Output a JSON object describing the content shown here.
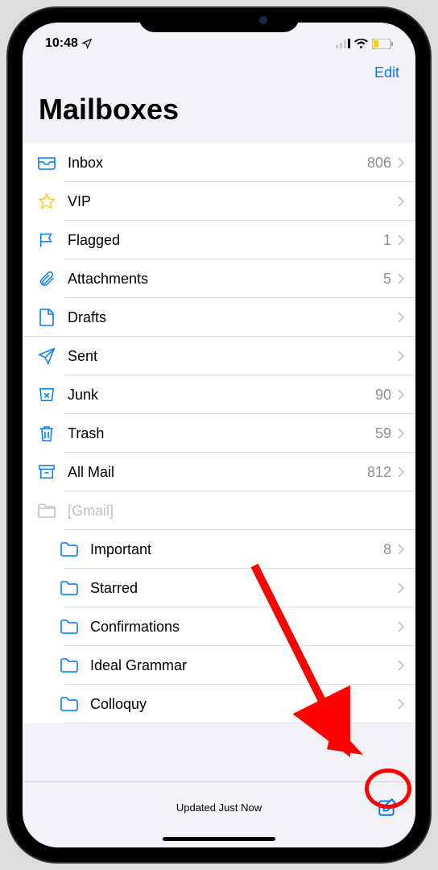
{
  "status": {
    "time": "10:48",
    "location_icon": "location-arrow"
  },
  "nav": {
    "edit_label": "Edit"
  },
  "title": "Mailboxes",
  "mailboxes": [
    {
      "icon": "inbox",
      "label": "Inbox",
      "count": "806",
      "indent": false
    },
    {
      "icon": "star",
      "label": "VIP",
      "count": "",
      "indent": false
    },
    {
      "icon": "flag",
      "label": "Flagged",
      "count": "1",
      "indent": false
    },
    {
      "icon": "paperclip",
      "label": "Attachments",
      "count": "5",
      "indent": false
    },
    {
      "icon": "draft",
      "label": "Drafts",
      "count": "",
      "indent": false,
      "fullBorder": true
    },
    {
      "icon": "paperplane",
      "label": "Sent",
      "count": "",
      "indent": false
    },
    {
      "icon": "junk",
      "label": "Junk",
      "count": "90",
      "indent": false
    },
    {
      "icon": "trash",
      "label": "Trash",
      "count": "59",
      "indent": false
    },
    {
      "icon": "archive",
      "label": "All Mail",
      "count": "812",
      "indent": false
    },
    {
      "icon": "folder-disabled",
      "label": "[Gmail]",
      "count": "",
      "indent": false,
      "disabled": true
    },
    {
      "icon": "folder",
      "label": "Important",
      "count": "8",
      "indent": true
    },
    {
      "icon": "folder",
      "label": "Starred",
      "count": "",
      "indent": true
    },
    {
      "icon": "folder",
      "label": "Confirmations",
      "count": "",
      "indent": true
    },
    {
      "icon": "folder",
      "label": "Ideal Grammar",
      "count": "",
      "indent": true
    },
    {
      "icon": "folder",
      "label": "Colloquy",
      "count": "",
      "indent": true
    }
  ],
  "toolbar": {
    "status": "Updated Just Now"
  },
  "colors": {
    "blue": "#007aff",
    "yellow": "#ffcc00",
    "gray": "#c0c0c4"
  }
}
